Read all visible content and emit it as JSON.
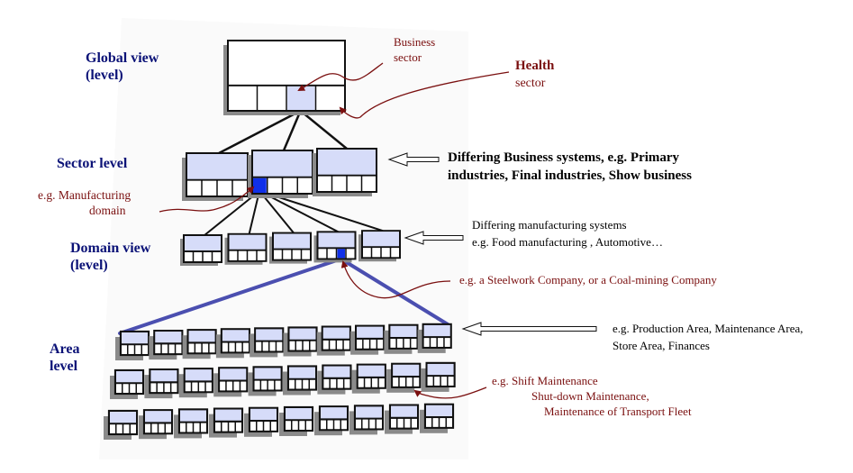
{
  "levels": {
    "global": {
      "line1": "Global view",
      "line2": "(level)"
    },
    "sector": {
      "line1": "Sector level"
    },
    "domain": {
      "line1": "Domain view",
      "line2": "(level)"
    },
    "area": {
      "line1": "Area",
      "line2": "level"
    }
  },
  "annotations": {
    "business_sector": {
      "line1": "Business",
      "line2": "sector"
    },
    "health_sector": {
      "line1": "Health",
      "line2": "sector"
    },
    "manufacturing_domain": {
      "line1": "e.g. Manufacturing",
      "line2": "domain"
    },
    "company": {
      "line1": "e.g. a Steelwork Company, or a Coal-mining Company"
    },
    "maintenance": {
      "line1": "e.g. Shift Maintenance",
      "line2": "Shut-down Maintenance,",
      "line3": "Maintenance of Transport Fleet"
    }
  },
  "descriptions": {
    "sector": {
      "line1": "Differing Business systems, e.g. Primary",
      "line2": "industries, Final industries, Show business"
    },
    "domain": {
      "line1": "Differing manufacturing systems",
      "line2": "e.g. Food manufacturing , Automotive…"
    },
    "area": {
      "line1": "e.g. Production Area, Maintenance Area,",
      "line2": "Store Area, Finances"
    }
  },
  "structure": {
    "sector_count": 3,
    "domain_count": 5,
    "area_rows": 3,
    "area_per_row": 10
  },
  "colors": {
    "level_label": "#0b1277",
    "annotation": "#7a0f0f",
    "box_fill": "#d6dcf9",
    "highlight": "#1030e8",
    "focus_line": "#4b4fb0"
  }
}
